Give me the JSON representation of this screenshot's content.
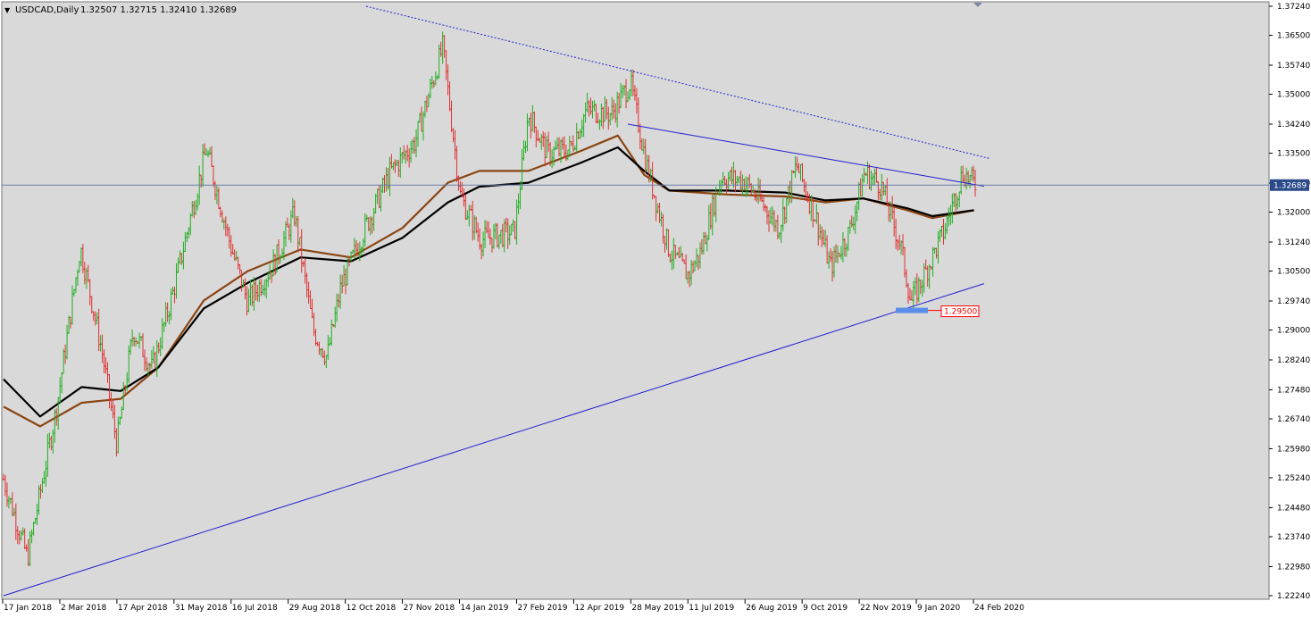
{
  "header": {
    "menu_glyph": "▼",
    "symbol": "USDCAD,Daily",
    "ohlc": "1.32507 1.32715 1.32410 1.32689"
  },
  "colors": {
    "background": "#d9d9d9",
    "bull_bar": "#1fae1f",
    "bear_bar": "#e03030",
    "ma_fast": "#8b4513",
    "ma_slow": "#000000",
    "trendline": "#1f1fd0",
    "price_line": "#6a7ca8",
    "current_price_box": "#2a4a8a",
    "level_label": "#ff0000"
  },
  "current_price_label": "1.32689",
  "level_label": "1.29500",
  "chart_data": {
    "type": "candlestick",
    "symbol": "USDCAD",
    "timeframe": "Daily",
    "ylim": [
      1.2224,
      1.3724
    ],
    "y_ticks": [
      "1.37240",
      "1.36500",
      "1.35740",
      "1.35000",
      "1.34240",
      "1.33500",
      "1.32740",
      "1.32000",
      "1.31240",
      "1.30500",
      "1.29740",
      "1.29000",
      "1.28240",
      "1.27480",
      "1.26740",
      "1.25980",
      "1.25240",
      "1.24480",
      "1.23740",
      "1.22980",
      "1.22240"
    ],
    "x_ticks": [
      "17 Jan 2018",
      "2 Mar 2018",
      "17 Apr 2018",
      "31 May 2018",
      "16 Jul 2018",
      "29 Aug 2018",
      "12 Oct 2018",
      "27 Nov 2018",
      "14 Jan 2019",
      "27 Feb 2019",
      "12 Apr 2019",
      "28 May 2019",
      "11 Jul 2019",
      "26 Aug 2019",
      "9 Oct 2019",
      "22 Nov 2019",
      "9 Jan 2020",
      "24 Feb 2020"
    ],
    "current_price": 1.32689,
    "horizontal_level": 1.295,
    "price_path": [
      {
        "date": "2018-01-17",
        "close": 1.252
      },
      {
        "date": "2018-02-05",
        "close": 1.232
      },
      {
        "date": "2018-02-28",
        "close": 1.27
      },
      {
        "date": "2018-03-19",
        "close": 1.311
      },
      {
        "date": "2018-04-05",
        "close": 1.285
      },
      {
        "date": "2018-04-17",
        "close": 1.261
      },
      {
        "date": "2018-04-30",
        "close": 1.29
      },
      {
        "date": "2018-05-15",
        "close": 1.28
      },
      {
        "date": "2018-06-01",
        "close": 1.3
      },
      {
        "date": "2018-06-27",
        "close": 1.336
      },
      {
        "date": "2018-07-16",
        "close": 1.312
      },
      {
        "date": "2018-07-30",
        "close": 1.297
      },
      {
        "date": "2018-08-20",
        "close": 1.307
      },
      {
        "date": "2018-09-05",
        "close": 1.3195
      },
      {
        "date": "2018-09-20",
        "close": 1.29
      },
      {
        "date": "2018-10-01",
        "close": 1.283
      },
      {
        "date": "2018-10-12",
        "close": 1.301
      },
      {
        "date": "2018-10-30",
        "close": 1.315
      },
      {
        "date": "2018-11-20",
        "close": 1.33
      },
      {
        "date": "2018-12-10",
        "close": 1.338
      },
      {
        "date": "2019-01-01",
        "close": 1.362
      },
      {
        "date": "2019-01-15",
        "close": 1.324
      },
      {
        "date": "2019-01-31",
        "close": 1.313
      },
      {
        "date": "2019-02-27",
        "close": 1.315
      },
      {
        "date": "2019-03-10",
        "close": 1.345
      },
      {
        "date": "2019-03-25",
        "close": 1.335
      },
      {
        "date": "2019-04-12",
        "close": 1.336
      },
      {
        "date": "2019-04-25",
        "close": 1.346
      },
      {
        "date": "2019-05-15",
        "close": 1.345
      },
      {
        "date": "2019-05-30",
        "close": 1.353
      },
      {
        "date": "2019-06-12",
        "close": 1.332
      },
      {
        "date": "2019-06-30",
        "close": 1.31
      },
      {
        "date": "2019-07-15",
        "close": 1.304
      },
      {
        "date": "2019-07-25",
        "close": 1.31
      },
      {
        "date": "2019-08-10",
        "close": 1.329
      },
      {
        "date": "2019-08-28",
        "close": 1.328
      },
      {
        "date": "2019-09-10",
        "close": 1.323
      },
      {
        "date": "2019-09-25",
        "close": 1.316
      },
      {
        "date": "2019-10-09",
        "close": 1.332
      },
      {
        "date": "2019-10-25",
        "close": 1.318
      },
      {
        "date": "2019-11-05",
        "close": 1.306
      },
      {
        "date": "2019-11-20",
        "close": 1.315
      },
      {
        "date": "2019-12-02",
        "close": 1.33
      },
      {
        "date": "2019-12-15",
        "close": 1.327
      },
      {
        "date": "2019-12-31",
        "close": 1.311
      },
      {
        "date": "2020-01-08",
        "close": 1.297
      },
      {
        "date": "2020-01-20",
        "close": 1.305
      },
      {
        "date": "2020-02-03",
        "close": 1.315
      },
      {
        "date": "2020-02-18",
        "close": 1.33
      },
      {
        "date": "2020-02-28",
        "close": 1.327
      }
    ],
    "moving_averages": [
      {
        "color": "#8b4513",
        "points": [
          {
            "date": "2018-01-17",
            "value": 1.2705
          },
          {
            "date": "2018-02-15",
            "value": 1.2655
          },
          {
            "date": "2018-03-20",
            "value": 1.2715
          },
          {
            "date": "2018-04-20",
            "value": 1.2725
          },
          {
            "date": "2018-05-20",
            "value": 1.2805
          },
          {
            "date": "2018-06-25",
            "value": 1.2975
          },
          {
            "date": "2018-07-30",
            "value": 1.305
          },
          {
            "date": "2018-09-10",
            "value": 1.3105
          },
          {
            "date": "2018-10-20",
            "value": 1.3085
          },
          {
            "date": "2018-11-30",
            "value": 1.316
          },
          {
            "date": "2019-01-05",
            "value": 1.3275
          },
          {
            "date": "2019-01-30",
            "value": 1.3305
          },
          {
            "date": "2019-03-10",
            "value": 1.3305
          },
          {
            "date": "2019-04-20",
            "value": 1.3355
          },
          {
            "date": "2019-05-20",
            "value": 1.3395
          },
          {
            "date": "2019-06-10",
            "value": 1.3295
          },
          {
            "date": "2019-06-30",
            "value": 1.3255
          },
          {
            "date": "2019-08-15",
            "value": 1.3245
          },
          {
            "date": "2019-09-30",
            "value": 1.324
          },
          {
            "date": "2019-11-01",
            "value": 1.3225
          },
          {
            "date": "2019-12-01",
            "value": 1.3235
          },
          {
            "date": "2020-01-05",
            "value": 1.3205
          },
          {
            "date": "2020-01-25",
            "value": 1.3185
          },
          {
            "date": "2020-02-27",
            "value": 1.3205
          }
        ]
      },
      {
        "color": "#000000",
        "points": [
          {
            "date": "2018-01-17",
            "value": 1.2775
          },
          {
            "date": "2018-02-15",
            "value": 1.268
          },
          {
            "date": "2018-03-20",
            "value": 1.2755
          },
          {
            "date": "2018-04-20",
            "value": 1.2745
          },
          {
            "date": "2018-05-20",
            "value": 1.2805
          },
          {
            "date": "2018-06-25",
            "value": 1.2955
          },
          {
            "date": "2018-07-30",
            "value": 1.302
          },
          {
            "date": "2018-09-10",
            "value": 1.3085
          },
          {
            "date": "2018-10-20",
            "value": 1.3075
          },
          {
            "date": "2018-11-30",
            "value": 1.3135
          },
          {
            "date": "2019-01-05",
            "value": 1.3225
          },
          {
            "date": "2019-01-30",
            "value": 1.3265
          },
          {
            "date": "2019-03-10",
            "value": 1.3275
          },
          {
            "date": "2019-04-20",
            "value": 1.3325
          },
          {
            "date": "2019-05-20",
            "value": 1.3365
          },
          {
            "date": "2019-06-10",
            "value": 1.3305
          },
          {
            "date": "2019-06-30",
            "value": 1.3255
          },
          {
            "date": "2019-08-15",
            "value": 1.3255
          },
          {
            "date": "2019-09-30",
            "value": 1.325
          },
          {
            "date": "2019-11-01",
            "value": 1.323
          },
          {
            "date": "2019-12-01",
            "value": 1.3235
          },
          {
            "date": "2020-01-05",
            "value": 1.321
          },
          {
            "date": "2020-01-25",
            "value": 1.319
          },
          {
            "date": "2020-02-27",
            "value": 1.3205
          }
        ]
      }
    ],
    "trendlines": [
      {
        "style": "dotted",
        "color": "#1f1fd0",
        "from": {
          "date": "2018-11-01",
          "value": 1.3724
        },
        "to": {
          "date": "2020-03-10",
          "value": 1.3337
        }
      },
      {
        "style": "solid",
        "color": "#1f1fd0",
        "from": {
          "date": "2019-05-28",
          "value": 1.3424
        },
        "to": {
          "date": "2020-03-06",
          "value": 1.3266
        }
      },
      {
        "style": "solid",
        "color": "#1f1fd0",
        "from": {
          "date": "2018-01-17",
          "value": 1.2224
        },
        "to": {
          "date": "2020-03-06",
          "value": 1.3018
        }
      }
    ]
  }
}
